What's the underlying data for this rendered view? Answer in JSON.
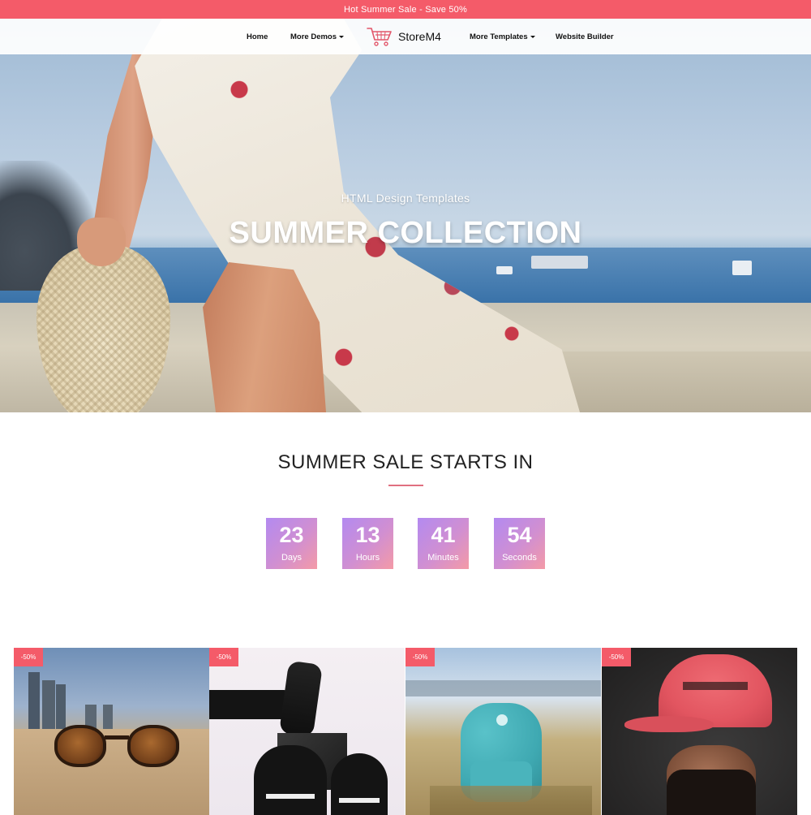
{
  "banner": {
    "text": "Hot Summer Sale - Save 50%"
  },
  "nav": {
    "home": "Home",
    "more_demos": "More Demos",
    "brand": "StoreM4",
    "more_templates": "More Templates",
    "website_builder": "Website Builder"
  },
  "hero": {
    "subtitle": "HTML Design Templates",
    "title": "SUMMER COLLECTION"
  },
  "countdown": {
    "heading": "SUMMER SALE STARTS IN",
    "items": [
      {
        "value": "23",
        "label": "Days"
      },
      {
        "value": "13",
        "label": "Hours"
      },
      {
        "value": "41",
        "label": "Minutes"
      },
      {
        "value": "54",
        "label": "Seconds"
      }
    ]
  },
  "products": [
    {
      "badge": "-50%",
      "image": "sunglasses-photo"
    },
    {
      "badge": "-50%",
      "image": "sneakers-photo"
    },
    {
      "badge": "-50%",
      "image": "backpack-photo"
    },
    {
      "badge": "-50%",
      "image": "cap-photo"
    }
  ],
  "colors": {
    "accent": "#f45b69",
    "countdown_gradient_start": "#b38af0",
    "countdown_gradient_end": "#f49aa6"
  }
}
